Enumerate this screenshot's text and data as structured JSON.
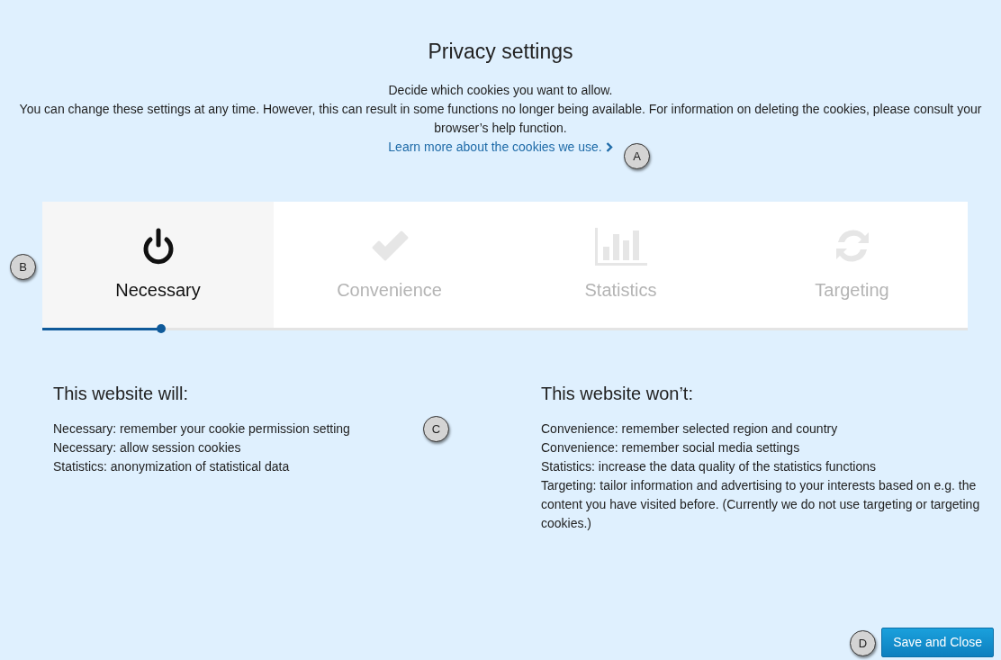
{
  "title": "Privacy settings",
  "intro": [
    "Decide which cookies you want to allow.",
    "You can change these settings at any time. However, this can result in some functions no longer being available. For information on deleting the cookies, please consult your browser’s help function."
  ],
  "learn_more_link": "Learn more about the cookies we use.",
  "tabs": [
    {
      "label": "Necessary",
      "kind": "power",
      "selected": true
    },
    {
      "label": "Convenience",
      "kind": "check",
      "selected": false
    },
    {
      "label": "Statistics",
      "kind": "chart",
      "selected": false
    },
    {
      "label": "Targeting",
      "kind": "refresh",
      "selected": false
    }
  ],
  "slider": {
    "level": 0.128
  },
  "will": {
    "heading": "This website will:",
    "items": [
      "Necessary: remember your cookie permission setting",
      "Necessary: allow session cookies",
      "Statistics: anonymization of statistical data"
    ]
  },
  "wont": {
    "heading": "This website won’t:",
    "items": [
      "Convenience: remember selected region and country",
      "Convenience: remember social media settings",
      "Statistics: increase the data quality of the statistics functions",
      "Targeting: tailor information and advertising to your interests based on e.g. the content you have visited before. (Currently we do not use targeting or targeting cookies.)"
    ]
  },
  "save_button": "Save and Close",
  "callouts": [
    {
      "label": "A"
    },
    {
      "label": "B"
    },
    {
      "label": "C"
    },
    {
      "label": "D"
    }
  ]
}
